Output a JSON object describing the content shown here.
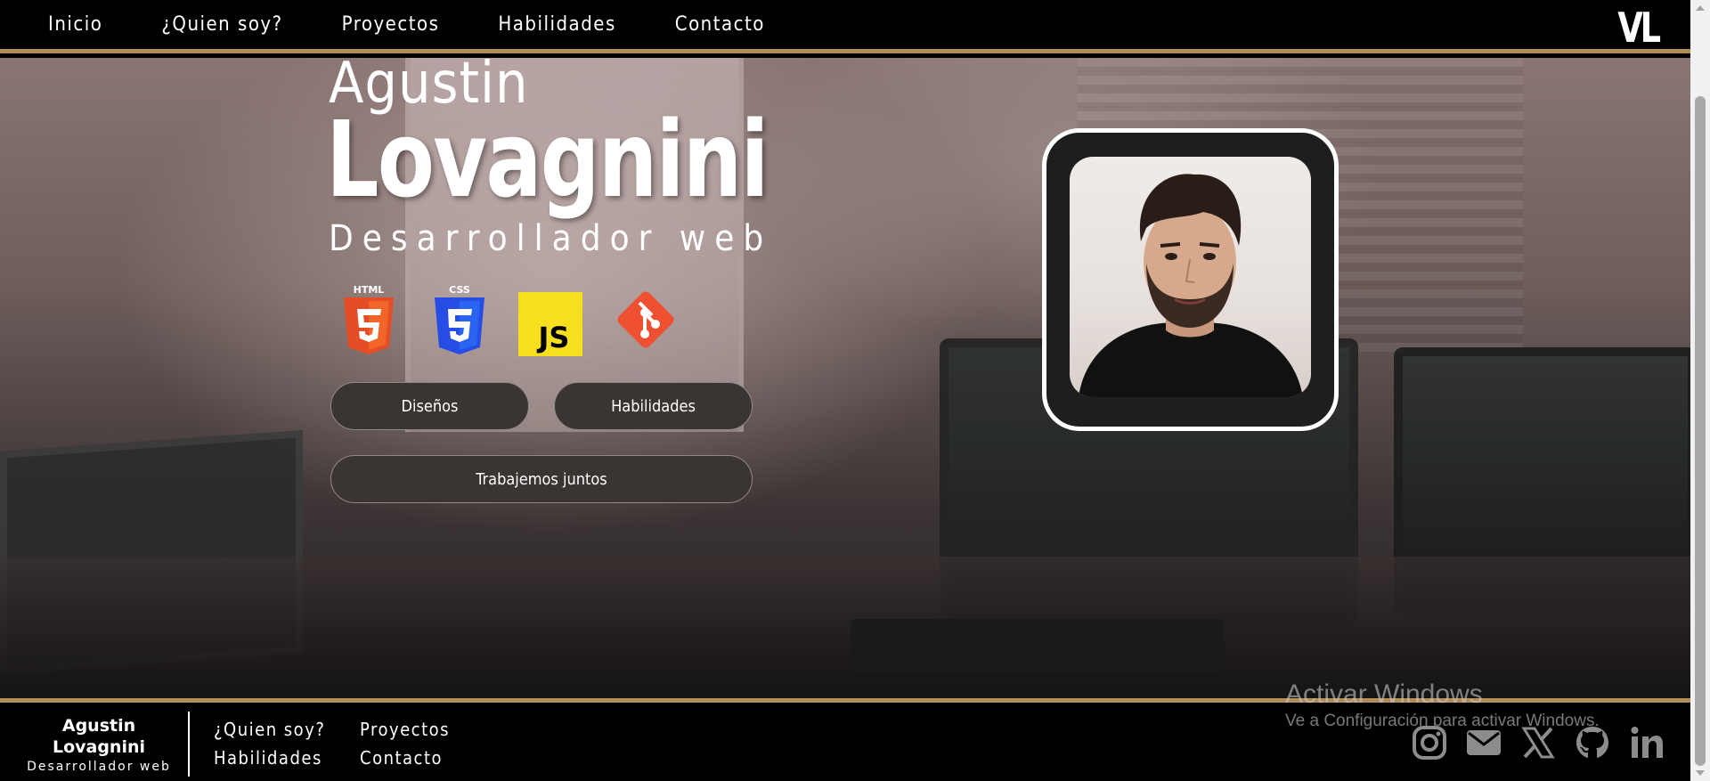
{
  "nav": {
    "links": [
      "Inicio",
      "¿Quien soy?",
      "Proyectos",
      "Habilidades",
      "Contacto"
    ],
    "logo": "VL"
  },
  "hero": {
    "first_name": "Agustin",
    "last_name": "Lovagnini",
    "role": "Desarrollador web",
    "tech_icons": [
      {
        "name": "html5-icon",
        "label": "HTML",
        "color": "#e44d26"
      },
      {
        "name": "css3-icon",
        "label": "CSS",
        "color": "#264de4"
      },
      {
        "name": "javascript-icon",
        "label": "JS",
        "color": "#f7df1e"
      },
      {
        "name": "git-icon",
        "color": "#f05032"
      }
    ],
    "buttons": {
      "disenos": "Diseños",
      "habilidades": "Habilidades",
      "trabajemos": "Trabajemos juntos"
    }
  },
  "footer": {
    "brand_name": "Agustin Lovagnini",
    "brand_role": "Desarrollador web",
    "links": [
      "¿Quien soy?",
      "Proyectos",
      "Habilidades",
      "Contacto"
    ],
    "social": [
      "instagram-icon",
      "email-icon",
      "x-icon",
      "github-icon",
      "linkedin-icon"
    ]
  },
  "watermark": {
    "title": "Activar Windows",
    "subtitle": "Ve a Configuración para activar Windows."
  },
  "colors": {
    "accent_gold": "#b38d56",
    "button_bg": "#3a3432",
    "nav_bg": "#000000"
  }
}
